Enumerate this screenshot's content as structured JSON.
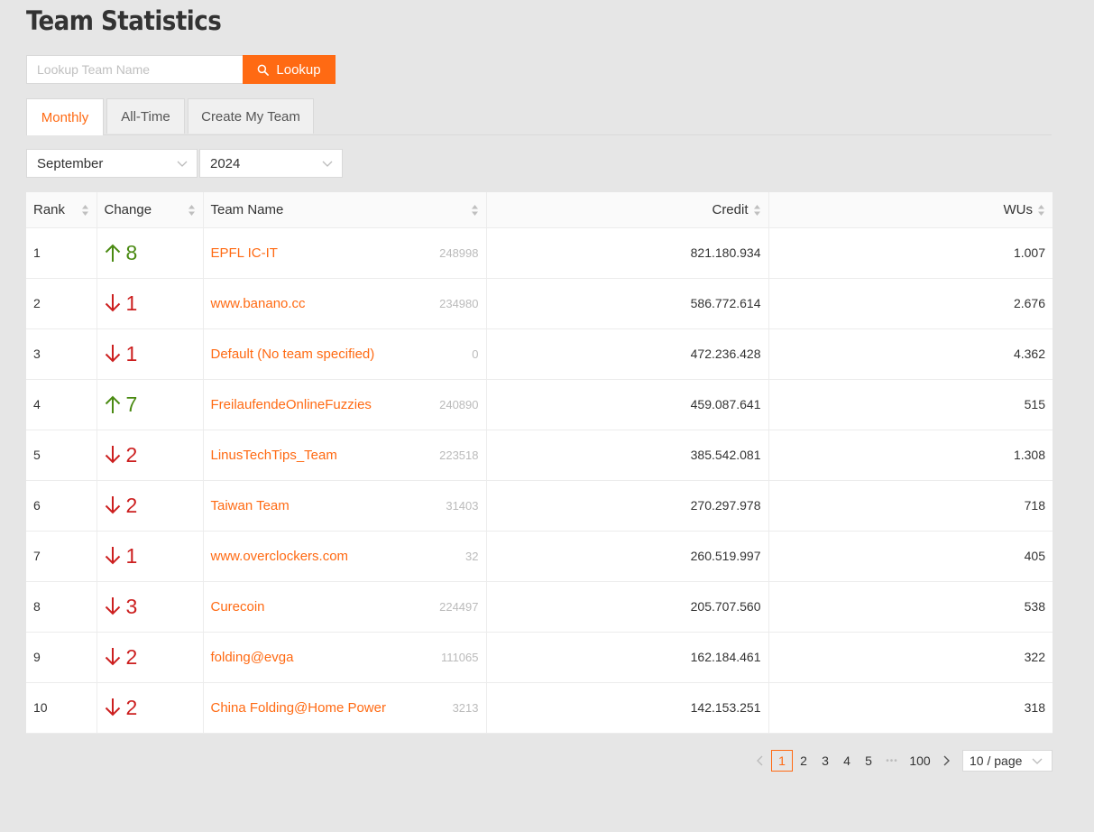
{
  "header": {
    "title": "Team Statistics"
  },
  "search": {
    "placeholder": "Lookup Team Name",
    "button_label": "Lookup"
  },
  "tabs": [
    {
      "label": "Monthly",
      "active": true
    },
    {
      "label": "All-Time",
      "active": false
    },
    {
      "label": "Create My Team",
      "active": false
    }
  ],
  "filters": {
    "month": "September",
    "year": "2024"
  },
  "table": {
    "columns": {
      "rank": "Rank",
      "change": "Change",
      "team": "Team Name",
      "credit": "Credit",
      "wus": "WUs"
    },
    "rows": [
      {
        "rank": "1",
        "dir": "up",
        "change": "8",
        "team": "EPFL IC-IT",
        "id": "248998",
        "credit": "821.180.934",
        "wus": "1.007"
      },
      {
        "rank": "2",
        "dir": "down",
        "change": "1",
        "team": "www.banano.cc",
        "id": "234980",
        "credit": "586.772.614",
        "wus": "2.676"
      },
      {
        "rank": "3",
        "dir": "down",
        "change": "1",
        "team": "Default (No team specified)",
        "id": "0",
        "credit": "472.236.428",
        "wus": "4.362"
      },
      {
        "rank": "4",
        "dir": "up",
        "change": "7",
        "team": "FreilaufendeOnlineFuzzies",
        "id": "240890",
        "credit": "459.087.641",
        "wus": "515"
      },
      {
        "rank": "5",
        "dir": "down",
        "change": "2",
        "team": "LinusTechTips_Team",
        "id": "223518",
        "credit": "385.542.081",
        "wus": "1.308"
      },
      {
        "rank": "6",
        "dir": "down",
        "change": "2",
        "team": "Taiwan Team",
        "id": "31403",
        "credit": "270.297.978",
        "wus": "718"
      },
      {
        "rank": "7",
        "dir": "down",
        "change": "1",
        "team": "www.overclockers.com",
        "id": "32",
        "credit": "260.519.997",
        "wus": "405"
      },
      {
        "rank": "8",
        "dir": "down",
        "change": "3",
        "team": "Curecoin",
        "id": "224497",
        "credit": "205.707.560",
        "wus": "538"
      },
      {
        "rank": "9",
        "dir": "down",
        "change": "2",
        "team": "folding@evga",
        "id": "111065",
        "credit": "162.184.461",
        "wus": "322"
      },
      {
        "rank": "10",
        "dir": "down",
        "change": "2",
        "team": "China Folding@Home Power",
        "id": "3213",
        "credit": "142.153.251",
        "wus": "318"
      }
    ]
  },
  "pagination": {
    "pages": [
      "1",
      "2",
      "3",
      "4",
      "5"
    ],
    "current": "1",
    "ellipsis": "•••",
    "last": "100",
    "page_size": "10 / page"
  },
  "colors": {
    "accent": "#ff6a13",
    "up": "#4a8a12",
    "down": "#cc1f1f"
  },
  "icons": {
    "up": "arrow-up-icon",
    "down": "arrow-down-icon",
    "search": "search-icon"
  }
}
